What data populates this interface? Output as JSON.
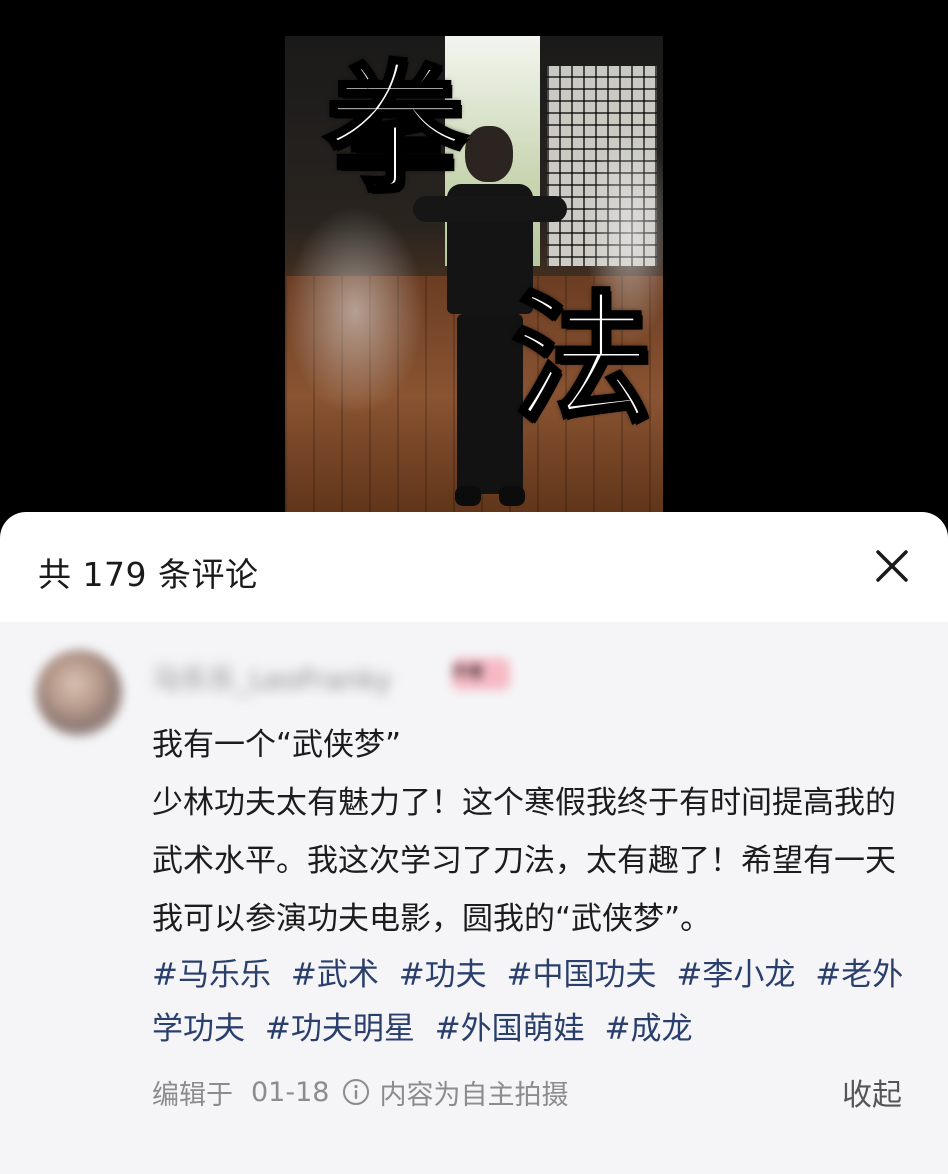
{
  "video": {
    "overlay_char_1": "拳",
    "overlay_char_2": "法"
  },
  "sheet": {
    "comment_count_label": "共 179 条评论"
  },
  "comment": {
    "username": "马乐乐_LeoFranky",
    "author_badge": "作者",
    "text_lines": [
      "我有一个“武侠梦”",
      "少林功夫太有魅力了！这个寒假我终于有时间提高我的武术水平。我这次学习了刀法，太有趣了！希望有一天我可以参演功夫电影，圆我的“武侠梦”。"
    ],
    "hashtags": [
      "#马乐乐",
      "#武术",
      "#功夫",
      "#中国功夫",
      "#李小龙",
      "#老外学功夫",
      "#功夫明星",
      "#外国萌娃",
      "#成龙"
    ],
    "edited_label": "编辑于",
    "date": "01-18",
    "self_shot_label": "内容为自主拍摄",
    "collapse_label": "收起"
  },
  "icons": {
    "close": "close-icon",
    "info": "info-icon"
  }
}
